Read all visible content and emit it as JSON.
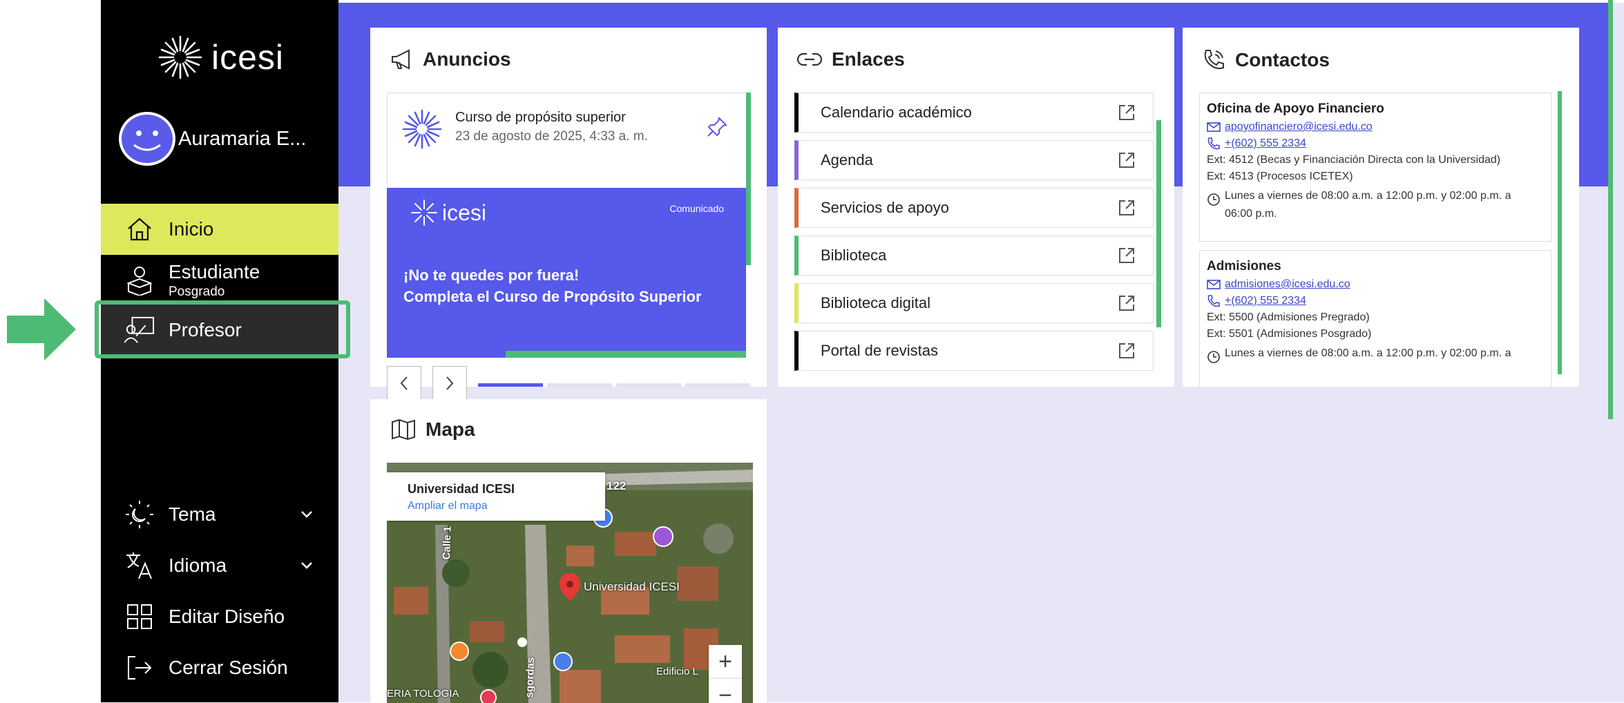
{
  "app": {
    "logo_text": "icesi"
  },
  "user": {
    "name": "Auramaria E..."
  },
  "nav": {
    "home": "Inicio",
    "student": "Estudiante",
    "student_sub": "Posgrado",
    "teacher": "Profesor",
    "theme": "Tema",
    "language": "Idioma",
    "edit_layout": "Editar Diseño",
    "logout": "Cerrar Sesión"
  },
  "announcements": {
    "title": "Anuncios",
    "item_title": "Curso de propósito superior",
    "item_date": "23 de agosto de 2025, 4:33 a. m.",
    "banner_logo": "icesi",
    "banner_tag": "Comunicado",
    "banner_line1": "¡No te quedes por fuera!",
    "banner_line2": "Completa el Curso de Propósito Superior"
  },
  "links": {
    "title": "Enlaces",
    "items": [
      {
        "label": "Calendario académico",
        "color": "#000000"
      },
      {
        "label": "Agenda",
        "color": "#8b63d9"
      },
      {
        "label": "Servicios de apoyo",
        "color": "#e0663a"
      },
      {
        "label": "Biblioteca",
        "color": "#4dbb75"
      },
      {
        "label": "Biblioteca digital",
        "color": "#dfe85b"
      },
      {
        "label": "Portal de revistas",
        "color": "#000000"
      }
    ]
  },
  "contacts": {
    "title": "Contactos",
    "items": [
      {
        "name": "Oficina de Apoyo Financiero",
        "email": "apoyofinanciero@icesi.edu.co",
        "phone": "+(602) 555 2334",
        "ext1": "Ext: 4512 (Becas y Financiación Directa con la Universidad)",
        "ext2": "Ext: 4513 (Procesos ICETEX)",
        "hours": "Lunes a viernes de 08:00 a.m. a 12:00 p.m. y 02:00 p.m. a 06:00 p.m."
      },
      {
        "name": "Admisiones",
        "email": "admisiones@icesi.edu.co",
        "phone": "+(602) 555 2334",
        "ext1": "Ext: 5500 (Admisiones Pregrado)",
        "ext2": "Ext: 5501 (Admisiones Posgrado)",
        "hours": "Lunes a viernes de 08:00 a.m. a 12:00 p.m. y 02:00 p.m. a"
      }
    ]
  },
  "map": {
    "title": "Mapa",
    "place_name": "Universidad ICESI",
    "expand_link": "Ampliar el mapa",
    "label_campus": "Universidad ICESI",
    "label_street1": "Calle 1",
    "label_street2": "sgordas",
    "label_122": "122",
    "label_edificio": "Edificio L",
    "label_bottom": "ERIA TOLOGIA",
    "zoom_in": "+",
    "zoom_out": "−"
  },
  "colors": {
    "accent_blue": "#5659ea",
    "accent_green": "#4dbb75",
    "accent_yellow": "#dfe85b",
    "sidebar_bg": "#000000"
  }
}
